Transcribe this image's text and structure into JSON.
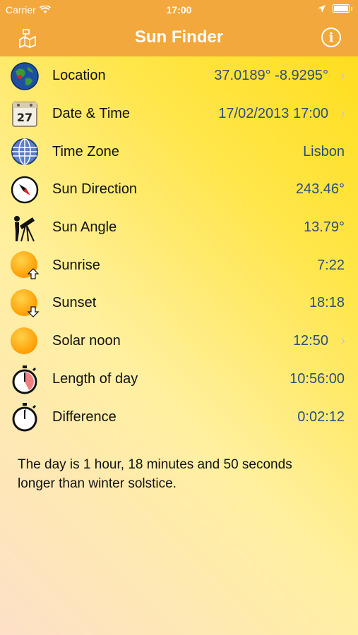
{
  "status": {
    "carrier": "Carrier",
    "time": "17:00"
  },
  "nav": {
    "title": "Sun Finder"
  },
  "rows": [
    {
      "label": "Location",
      "value": "37.0189° -8.9295°",
      "icon": "globe-icon"
    },
    {
      "label": "Date & Time",
      "value": "17/02/2013 17:00",
      "icon": "calendar-icon"
    },
    {
      "label": "Time Zone",
      "value": "Lisbon",
      "icon": "timezone-globe-icon"
    },
    {
      "label": "Sun Direction",
      "value": "243.46°",
      "icon": "compass-icon"
    },
    {
      "label": "Sun Angle",
      "value": "13.79°",
      "icon": "telescope-icon"
    },
    {
      "label": "Sunrise",
      "value": "7:22",
      "icon": "sunrise-icon"
    },
    {
      "label": "Sunset",
      "value": "18:18",
      "icon": "sunset-icon"
    },
    {
      "label": "Solar noon",
      "value": "12:50",
      "icon": "sun-icon"
    },
    {
      "label": "Length of day",
      "value": "10:56:00",
      "icon": "stopwatch-icon"
    },
    {
      "label": "Difference",
      "value": "0:02:12",
      "icon": "stopwatch-icon"
    }
  ],
  "note": "The day is 1 hour, 18 minutes and 50 seconds longer than winter solstice.",
  "colors": {
    "bar": "#f2a83c",
    "value": "#2a4e78",
    "sun": "#ffa200"
  }
}
